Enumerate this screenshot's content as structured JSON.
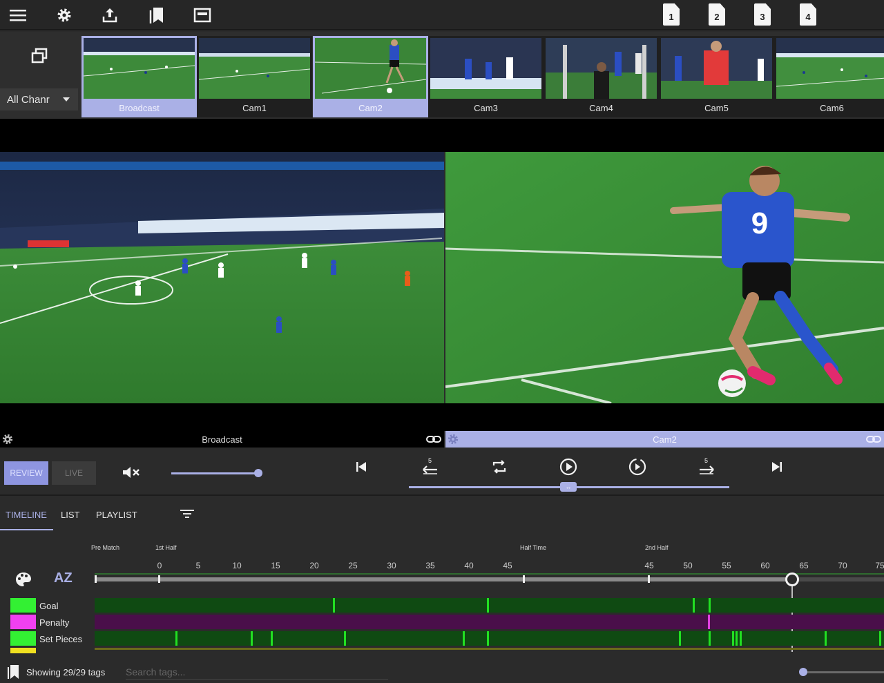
{
  "thumbnails": [
    {
      "label": "Broadcast",
      "selected": true
    },
    {
      "label": "Cam1",
      "selected": false
    },
    {
      "label": "Cam2",
      "selected": true
    },
    {
      "label": "Cam3",
      "selected": false
    },
    {
      "label": "Cam4",
      "selected": false
    },
    {
      "label": "Cam5",
      "selected": false
    },
    {
      "label": "Cam6",
      "selected": false
    }
  ],
  "channel_select": {
    "value": "All Chanr"
  },
  "doc_icons": [
    "1",
    "2",
    "3",
    "4"
  ],
  "panes": {
    "left_caption": "Broadcast",
    "right_caption": "Cam2",
    "player_number": "9"
  },
  "transport": {
    "review_label": "REVIEW",
    "live_label": "LIVE",
    "skip_back_label": "5",
    "skip_forward_label": "5",
    "volume_level": 0.98,
    "scrub_position": 0.49
  },
  "tabs": [
    {
      "label": "TIMELINE",
      "active": true
    },
    {
      "label": "LIST",
      "active": false
    },
    {
      "label": "PLAYLIST",
      "active": false
    }
  ],
  "timeline": {
    "periods": [
      "Pre Match",
      "1st Half",
      "Half Time",
      "2nd Half"
    ],
    "ticks_first_half": [
      "0",
      "5",
      "10",
      "15",
      "20",
      "25",
      "30",
      "35",
      "40",
      "45"
    ],
    "ticks_second_half": [
      "45",
      "50",
      "55",
      "60",
      "65",
      "70",
      "75"
    ],
    "legend": [
      {
        "label": "Goal",
        "color": "#33f033"
      },
      {
        "label": "Penalty",
        "color": "#f040f0"
      },
      {
        "label": "Set Pieces",
        "color": "#33f033"
      }
    ],
    "track_colors": {
      "goal_bg": "#0f4a12",
      "penalty_bg": "#4a0f4a",
      "setpieces_bg": "#0f4a12",
      "event": "#22e022",
      "penalty_event": "#e040e0"
    }
  },
  "status": {
    "showing_text": "Showing 29/29 tags",
    "search_placeholder": "Search tags..."
  },
  "colors": {
    "accent": "#aab0e6",
    "accent_strong": "#8e95e0",
    "background": "#2b2b2b"
  }
}
